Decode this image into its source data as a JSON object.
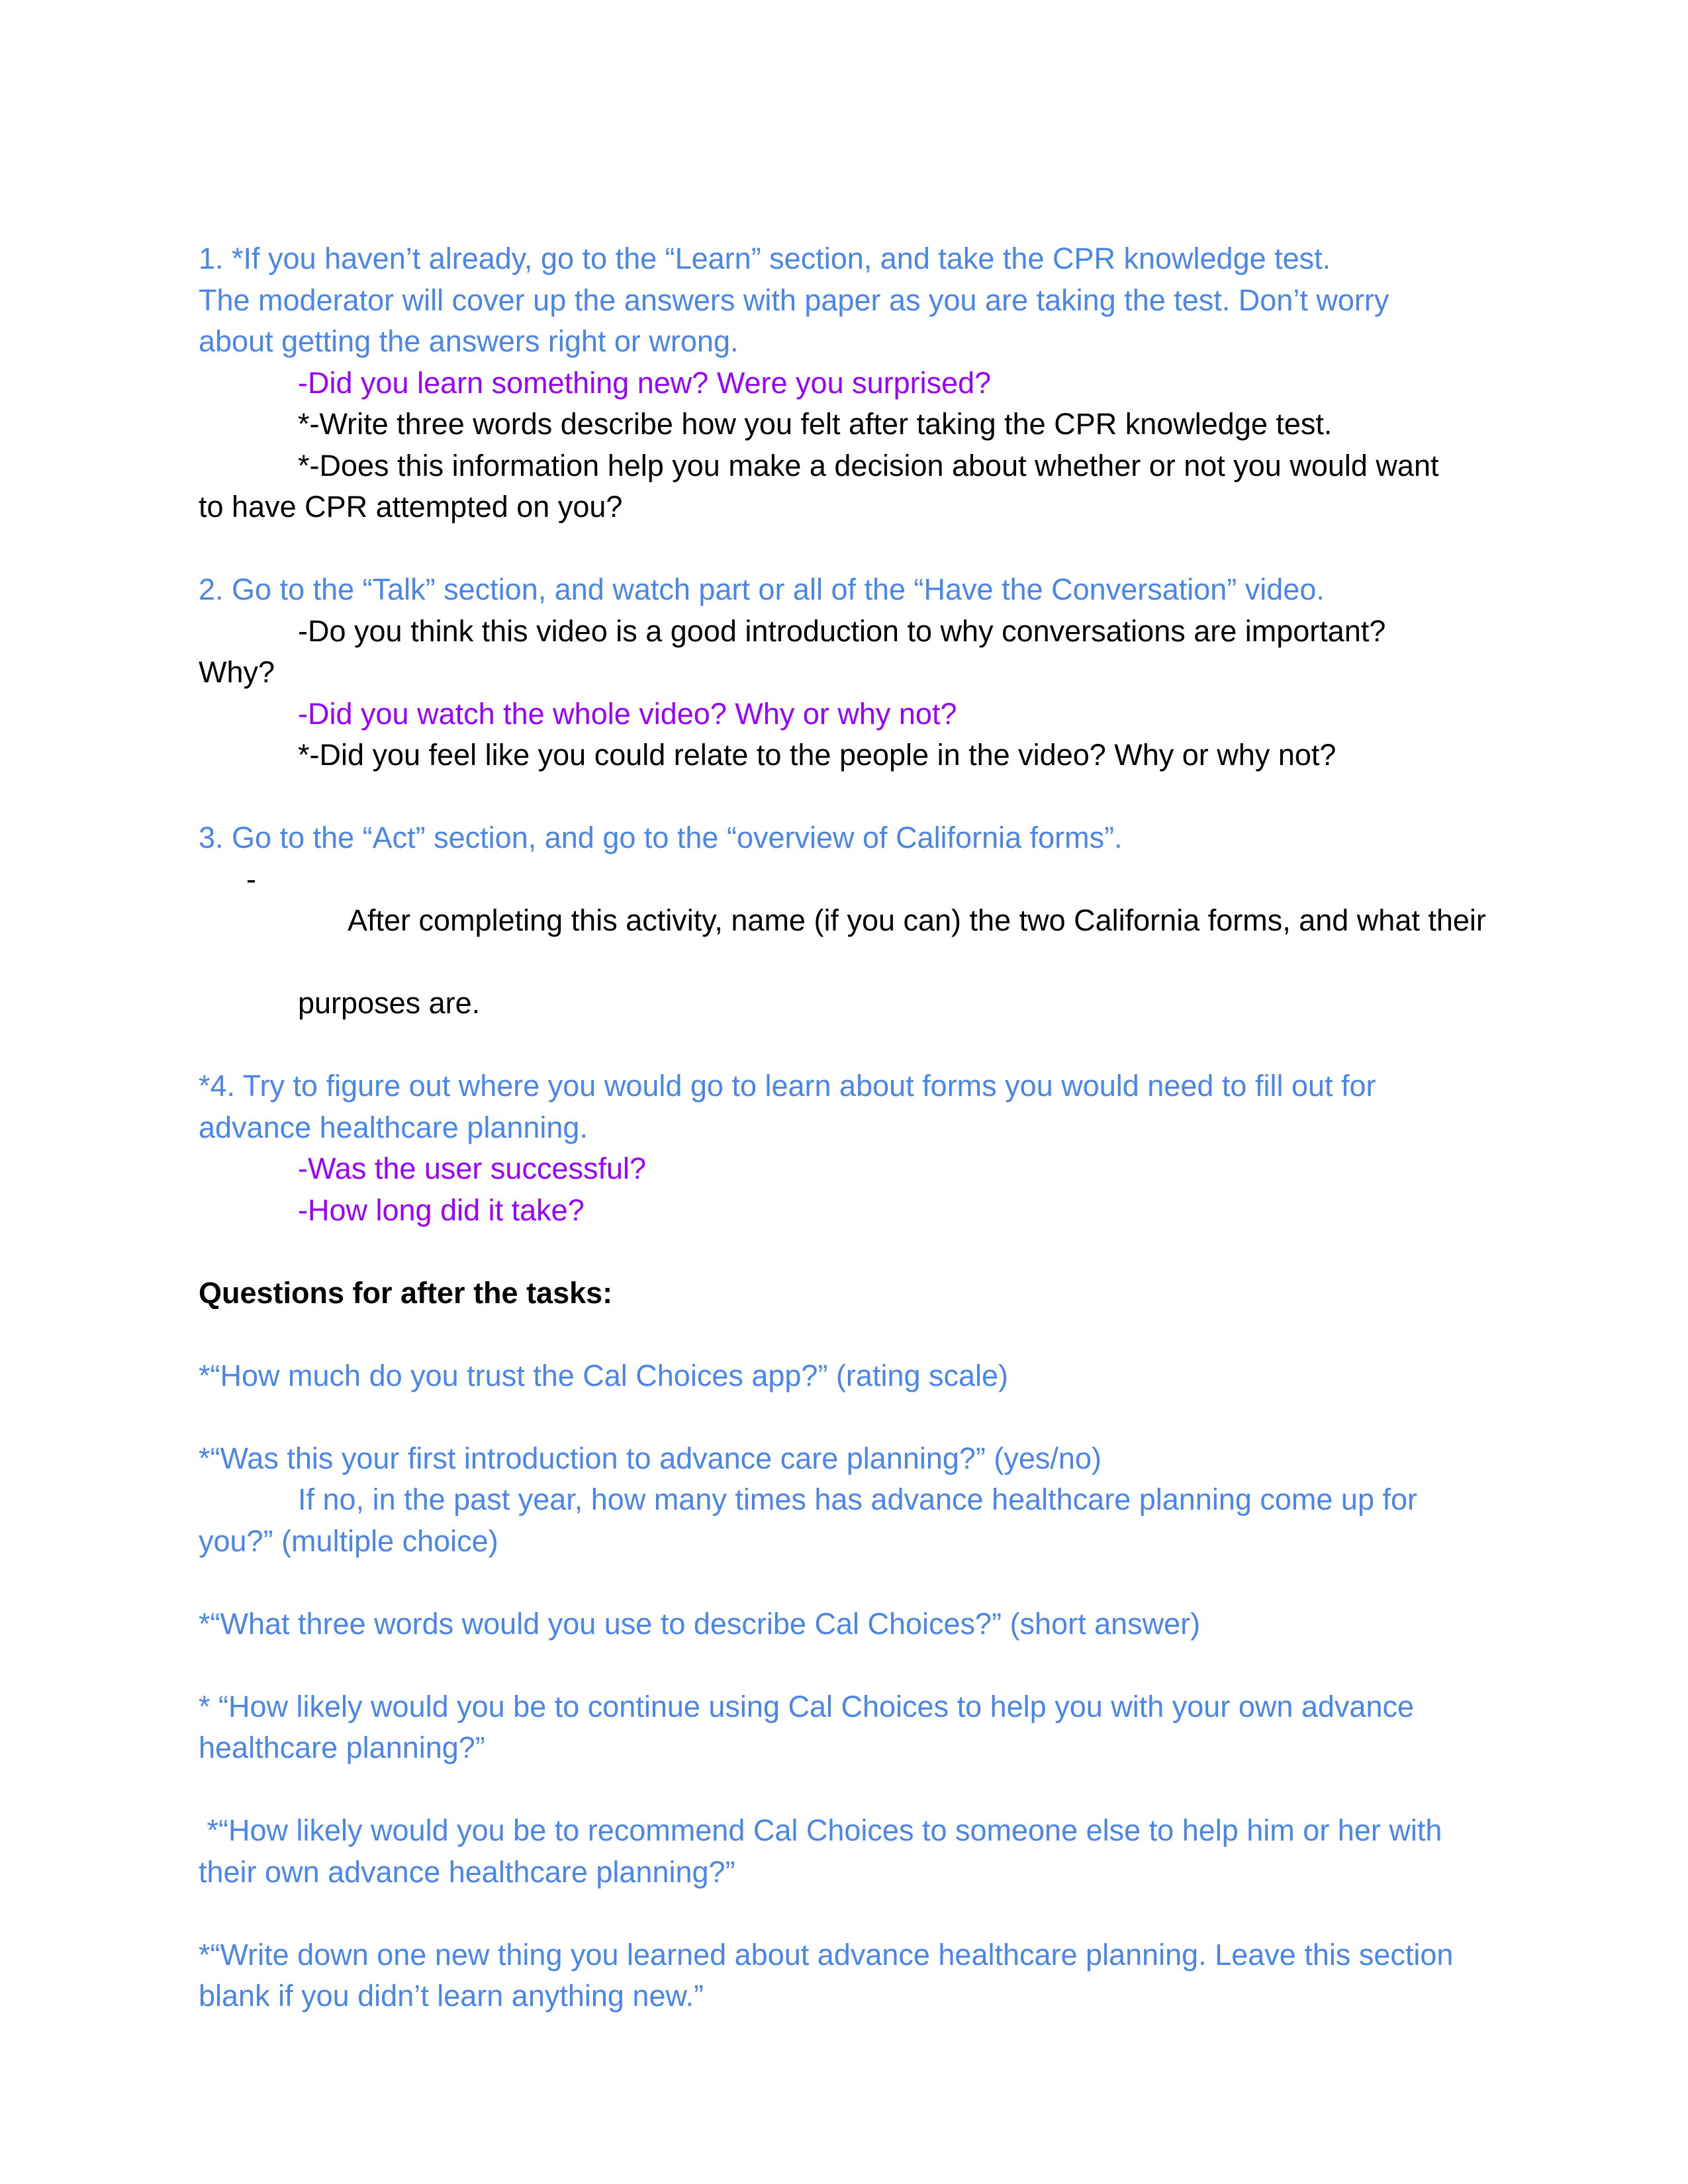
{
  "colors": {
    "task_blue": "#4a86e8",
    "question_purple": "#9900ff",
    "text_black": "#000000"
  },
  "task1": {
    "line1": "1. *If you haven’t already, go to the “Learn” section, and take the CPR knowledge test.",
    "line2": "The moderator will cover up the answers with paper as you are taking the test. Don’t worry",
    "line3": "about getting the answers right or wrong.",
    "q1": "-Did you learn something new? Were you surprised?",
    "q2": "*-Write three words describe how you felt after taking the CPR knowledge test.",
    "q3_line1": "*-Does this information help you make a decision about whether or not you would want",
    "q3_line2": "to have CPR attempted on you?"
  },
  "task2": {
    "line1": "2. Go to the “Talk” section, and watch part or all of the “Have the Conversation” video.",
    "q1_line1": "-Do you think this video is a good introduction to why conversations are important?",
    "q1_line2": "Why?",
    "q2": "-Did you watch the whole video? Why or why not?",
    "q3": "*-Did you feel like you could relate to the people in the video? Why or why not?"
  },
  "task3": {
    "line1": "3. Go to the “Act” section, and go to the “overview of California forms”.",
    "bullet_marker": "-",
    "bullet_line1": "After completing this activity, name (if you can) the two California forms, and what their",
    "bullet_line2": "purposes are."
  },
  "task4": {
    "line1": "*4. Try to figure out where you would go to learn about forms you would need to fill out for",
    "line2": "advance healthcare planning.",
    "q1": "-Was the user successful?",
    "q2": "-How long did it take?"
  },
  "after_tasks": {
    "heading": "Questions for after the tasks:",
    "q1": "*“How much do you trust the Cal Choices app?” (rating scale)",
    "q2_line1": "*“Was this your first introduction to advance care planning?” (yes/no)",
    "q2_line2": "If no, in the past year, how many times has advance healthcare planning come up for",
    "q2_line3": "you?” (multiple choice)",
    "q3": "*“What three words would you use to describe Cal Choices?” (short answer)",
    "q4_line1": "* “How likely would you be to continue using Cal Choices to help you with your own advance",
    "q4_line2": "healthcare planning?”",
    "q5_line1": " *“How likely would you be to recommend Cal Choices to someone else to help him or her with",
    "q5_line2": "their own advance healthcare planning?”",
    "q6_line1": "*“Write down one new thing you learned about advance healthcare planning. Leave this section",
    "q6_line2": "blank if you didn’t learn anything new.”"
  }
}
